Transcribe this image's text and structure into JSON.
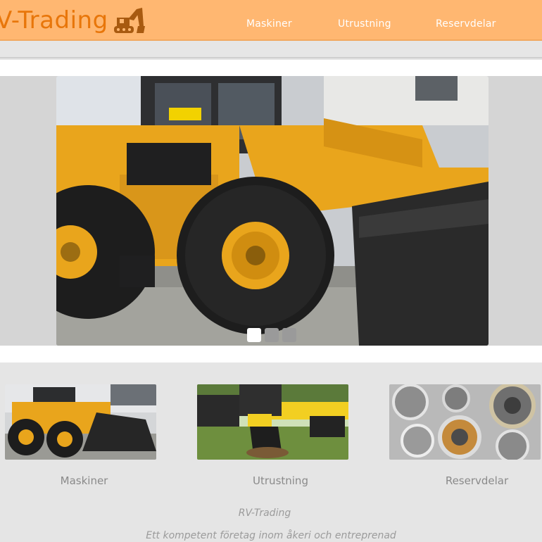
{
  "header": {
    "logo_text": "V-Trading",
    "logo_icon": "excavator-icon",
    "nav": [
      {
        "label": "Maskiner"
      },
      {
        "label": "Utrustning"
      },
      {
        "label": "Reservdelar"
      }
    ]
  },
  "slider": {
    "image": "yellow-wheel-loader-photo",
    "dots": [
      {
        "active": true
      },
      {
        "active": false
      },
      {
        "active": false
      }
    ]
  },
  "cards": [
    {
      "label": "Maskiner",
      "image": "wheel-loader-photo"
    },
    {
      "label": "Utrustning",
      "image": "excavator-attachment-photo"
    },
    {
      "label": "Reservdelar",
      "image": "gears-and-bearings-photo"
    }
  ],
  "footer": {
    "title": "RV-Trading",
    "subtitle": "Ett kompetent företag inom åkeri och entreprenad"
  },
  "colors": {
    "header_bg": "#ffb771",
    "logo_orange": "#e8760a",
    "loader_yellow": "#e9a51c"
  }
}
